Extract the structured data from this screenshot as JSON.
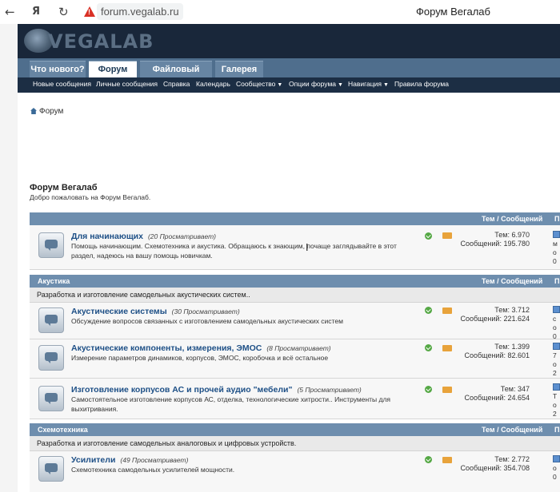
{
  "browser": {
    "url": "forum.vegalab.ru",
    "tab_title": "Форум Вегалаб",
    "warning": "!"
  },
  "site": {
    "logo": "VEGALAB"
  },
  "nav": {
    "tabs": [
      "Что нового?",
      "Форум",
      "Файловый архив",
      "Галерея"
    ],
    "sublinks": [
      "Новые сообщения",
      "Личные сообщения",
      "Справка",
      "Календарь",
      "Сообщество",
      "Опции форума",
      "Навигация",
      "Правила форума"
    ]
  },
  "breadcrumb": "Форум",
  "page": {
    "title": "Форум Вегалаб",
    "subtitle": "Добро пожаловать на Форум Вегалаб."
  },
  "columns": {
    "stats": "Тем / Сообщений",
    "last": "П"
  },
  "sections": [
    {
      "name": "",
      "desc": ""
    },
    {
      "name": "Акустика",
      "desc": "Разработка и изготовление самодельных акустических систем.."
    },
    {
      "name": "Схемотехника",
      "desc": "Разработка и изготовление самодельных аналоговых и цифровых устройств."
    }
  ],
  "forums": [
    {
      "title": "Для начинающих",
      "views": "(20 Просматривает)",
      "desc": "Помощь начинающим. Схемотехника и акустика. Обращаюсь к знающим, почаще заглядывайте в этот раздел, надеюсь на вашу помощь новичкам.",
      "topics": "Тем: 6.970",
      "posts": "Сообщений: 195.780",
      "last": [
        "м",
        "о",
        "0"
      ]
    },
    {
      "title": "Акустические системы",
      "views": "(30 Просматривает)",
      "desc": "Обсуждение вопросов связанных с изготовлением самодельных акустических систем",
      "topics": "Тем: 3.712",
      "posts": "Сообщений: 221.624",
      "last": [
        "с",
        "о",
        "0"
      ]
    },
    {
      "title": "Акустические компоненты, измерения, ЭМОС",
      "views": "(8 Просматривает)",
      "desc": "Измерение параметров динамиков, корпусов, ЭМОС, коробочка и всё остальное",
      "topics": "Тем: 1.399",
      "posts": "Сообщений: 82.601",
      "last": [
        "7",
        "о",
        "2"
      ]
    },
    {
      "title": "Изготовление корпусов АС и прочей аудио \"мебели\"",
      "views": "(5 Просматривает)",
      "desc": "Самостоятельное изготовление корпусов АС, отделка, технологические хитрости.. Инструменты для выхитривания.",
      "topics": "Тем: 347",
      "posts": "Сообщений: 24.654",
      "last": [
        "Т",
        "о",
        "2"
      ]
    },
    {
      "title": "Усилители",
      "views": "(49 Просматривает)",
      "desc": "Схемотехника самодельных усилителей мощности.",
      "topics": "Тем: 2.772",
      "posts": "Сообщений: 354.708",
      "last": [
        "о",
        "0",
        ""
      ]
    }
  ]
}
